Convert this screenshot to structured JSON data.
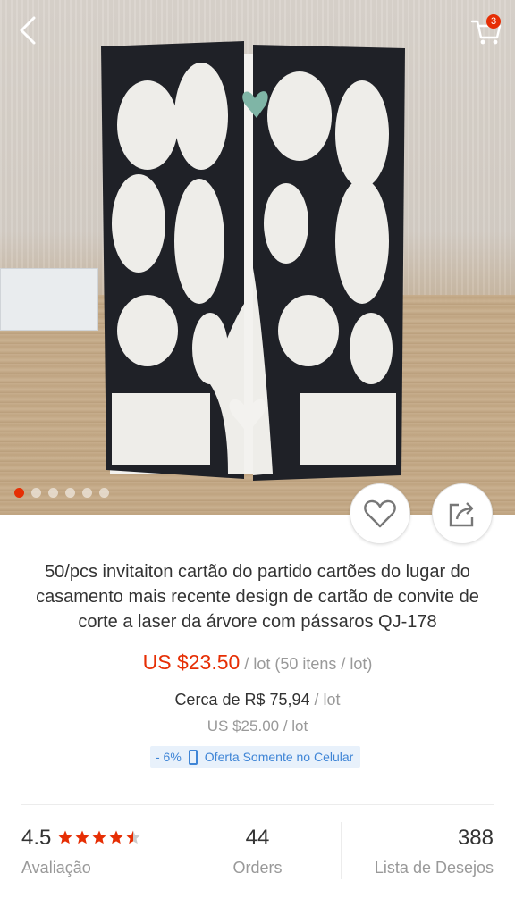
{
  "header": {
    "back_icon": "chevron-left-icon",
    "cart_icon": "cart-icon",
    "cart_count": "3"
  },
  "gallery": {
    "image_count": 6,
    "active_index": 0
  },
  "actions": {
    "wishlist_icon": "heart-outline-icon",
    "share_icon": "share-icon"
  },
  "product": {
    "title": "50/pcs invitaiton cartão do partido cartões do lugar do casamento mais recente design de cartão de convite de corte a laser da árvore com pássaros QJ-178",
    "price": "US $23.50",
    "price_unit": " / lot (50 itens / lot)",
    "local_price": "Cerca de R$ 75,94",
    "local_unit": " / lot",
    "original_price": "US $25.00 / lot",
    "discount": "- 6%",
    "promo_text": "Oferta Somente no Celular"
  },
  "stats": {
    "rating_value": "4.5",
    "rating_stars": 4.5,
    "rating_label": "Avaliação",
    "orders_value": "44",
    "orders_label": "Orders",
    "wishlist_value": "388",
    "wishlist_label": "Lista de Desejos"
  },
  "colors": {
    "accent": "#e62e04",
    "promo_blue": "#3f85d6",
    "muted": "#999999"
  }
}
